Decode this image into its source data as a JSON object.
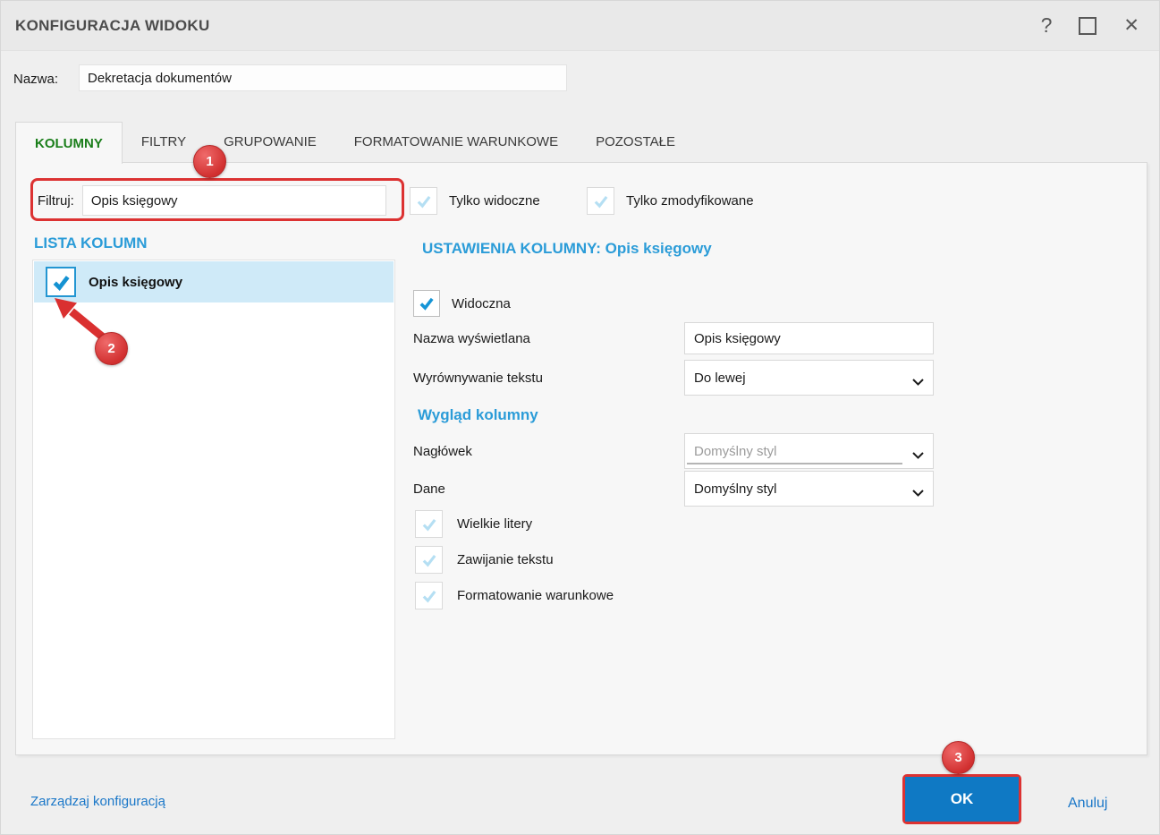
{
  "window": {
    "title": "KONFIGURACJA WIDOKU",
    "icons": {
      "help": "?",
      "close": "✕"
    }
  },
  "name_field": {
    "label": "Nazwa:",
    "value": "Dekretacja dokumentów"
  },
  "tabs": [
    {
      "label": "KOLUMNY",
      "active": true
    },
    {
      "label": "FILTRY",
      "active": false
    },
    {
      "label": "GRUPOWANIE",
      "active": false
    },
    {
      "label": "FORMATOWANIE WARUNKOWE",
      "active": false
    },
    {
      "label": "POZOSTAŁE",
      "active": false
    }
  ],
  "filter": {
    "label": "Filtruj:",
    "value": "Opis księgowy"
  },
  "visibility_toggles": [
    {
      "label": "Tylko widoczne",
      "state": "faded-check"
    },
    {
      "label": "Tylko zmodyfikowane",
      "state": "faded-check"
    }
  ],
  "column_list": {
    "header": "LISTA KOLUMN",
    "items": [
      {
        "label": "Opis księgowy",
        "checked": true,
        "selected": true
      }
    ]
  },
  "column_settings": {
    "header": "USTAWIENIA KOLUMNY: Opis księgowy",
    "visible_checkbox": {
      "label": "Widoczna",
      "checked": true
    },
    "display_name": {
      "label": "Nazwa wyświetlana",
      "value": "Opis księgowy"
    },
    "text_alignment": {
      "label": "Wyrównywanie tekstu",
      "value": "Do lewej"
    },
    "appearance": {
      "header": "Wygląd kolumny",
      "header_style": {
        "label": "Nagłówek",
        "value": "Domyślny styl",
        "disabled": true
      },
      "data_style": {
        "label": "Dane",
        "value": "Domyślny styl",
        "disabled": false
      },
      "options": [
        {
          "label": "Wielkie litery",
          "state": "faded-check"
        },
        {
          "label": "Zawijanie tekstu",
          "state": "faded-check"
        },
        {
          "label": "Formatowanie warunkowe",
          "state": "faded-check"
        }
      ]
    }
  },
  "footer": {
    "manage_link": "Zarządzaj konfiguracją",
    "ok": "OK",
    "cancel": "Anuluj"
  },
  "annotations": {
    "steps": [
      "1",
      "2",
      "3"
    ]
  },
  "colors": {
    "accent_cyan": "#2b9cd8",
    "check_blue": "#1695d6",
    "ok_blue": "#0f79c4",
    "active_tab_green": "#1a7e1a",
    "annotation_red": "#dc3232",
    "selection_bg": "#cfeaf8",
    "link_blue": "#1a77c8"
  }
}
